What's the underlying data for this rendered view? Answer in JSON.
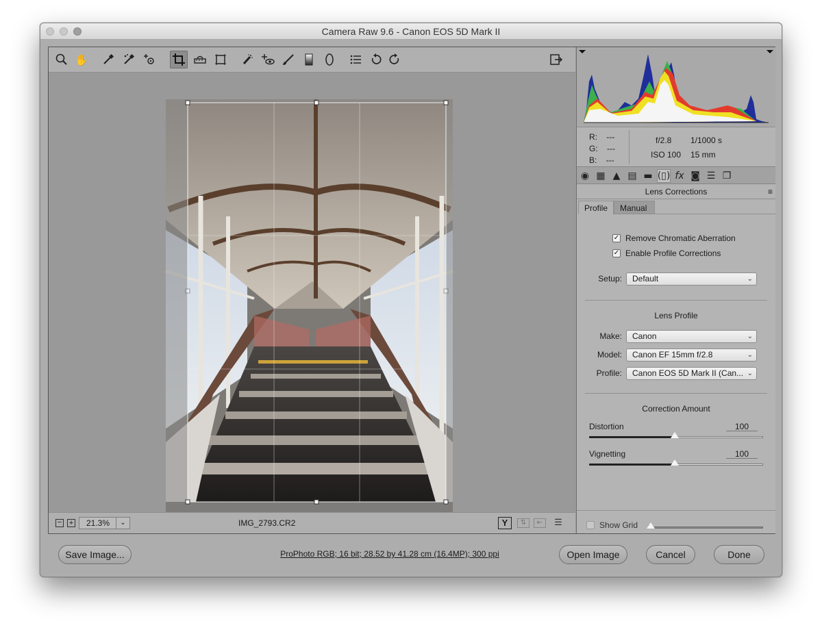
{
  "window": {
    "title": "Camera Raw 9.6  -  Canon EOS 5D Mark II"
  },
  "toolbar": {
    "tools": [
      "zoom-icon",
      "hand-icon",
      "white-balance-icon",
      "color-sampler-icon",
      "targeted-adjustment-icon",
      "crop-icon",
      "straighten-icon",
      "transform-icon",
      "spot-removal-icon",
      "red-eye-icon",
      "adjustment-brush-icon",
      "graduated-filter-icon",
      "radial-filter-icon",
      "preferences-icon",
      "rotate-ccw-icon",
      "rotate-cw-icon"
    ],
    "fullscreen_icon": "toggle-fullscreen-icon"
  },
  "status": {
    "zoom": "21.3%",
    "filename": "IMG_2793.CR2",
    "compare_label": "Y"
  },
  "readout": {
    "r_label": "R:",
    "g_label": "G:",
    "b_label": "B:",
    "r": "---",
    "g": "---",
    "b": "---",
    "aperture": "f/2.8",
    "shutter": "1/1000 s",
    "iso": "ISO 100",
    "focal": "15 mm"
  },
  "panel": {
    "title": "Lens Corrections",
    "subtabs": [
      "Profile",
      "Manual"
    ],
    "active_subtab": "Profile",
    "remove_ca_label": "Remove Chromatic Aberration",
    "remove_ca_checked": true,
    "enable_profile_label": "Enable Profile Corrections",
    "enable_profile_checked": true,
    "setup_label": "Setup:",
    "setup_value": "Default",
    "lens_profile_heading": "Lens Profile",
    "make_label": "Make:",
    "make_value": "Canon",
    "model_label": "Model:",
    "model_value": "Canon EF 15mm f/2.8",
    "profile_label": "Profile:",
    "profile_value": "Canon EOS 5D Mark II (Can...",
    "correction_heading": "Correction Amount",
    "distortion_label": "Distortion",
    "distortion_value": "100",
    "vignetting_label": "Vignetting",
    "vignetting_value": "100",
    "show_grid_label": "Show Grid",
    "show_grid_checked": false
  },
  "bottom": {
    "save_label": "Save Image...",
    "workflow_link": "ProPhoto RGB; 16 bit; 28.52 by 41.28 cm (16.4MP); 300 ppi",
    "open_label": "Open Image",
    "cancel_label": "Cancel",
    "done_label": "Done"
  },
  "colors": {
    "accent_active": "#8d8d8d",
    "panel_bg": "#b4b4b4",
    "canvas_bg": "#999999"
  }
}
